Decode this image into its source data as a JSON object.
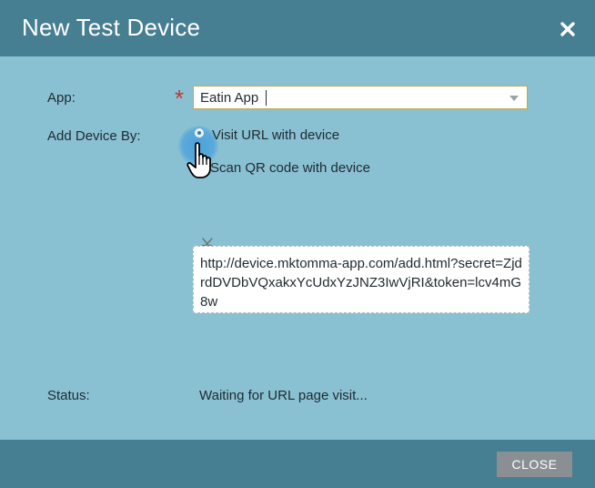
{
  "dialog": {
    "title": "New Test Device",
    "close_icon": "close-x-icon"
  },
  "form": {
    "app_label": "App:",
    "required_marker": "*",
    "app_value": "Eatin App",
    "add_device_label": "Add Device By:",
    "options": [
      {
        "label": "Visit URL with device",
        "selected": true
      },
      {
        "label": "Scan QR code with device",
        "selected": false
      }
    ],
    "url": "http://device.mktomma-app.com/add.html?secret=ZjdrdDVDbVQxakxYcUdxYzJNZ3IwVjRI&token=lcv4mG8w",
    "status_label": "Status:",
    "status_value": "Waiting for URL page visit..."
  },
  "footer": {
    "close_label": "CLOSE"
  },
  "colors": {
    "header_bg": "#467e92",
    "body_bg": "#89c1d3",
    "close_button_bg": "#8a8f93",
    "required": "#c0392b"
  }
}
